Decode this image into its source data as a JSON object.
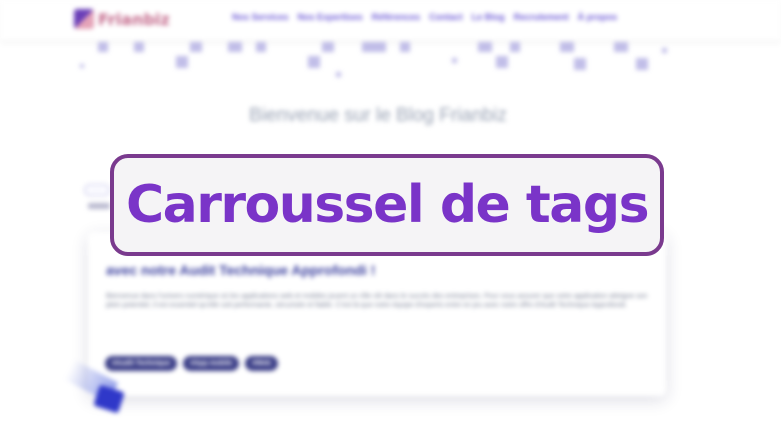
{
  "overlay": {
    "label": "Carroussel de tags"
  },
  "header": {
    "logo_text": "Frianbiz",
    "nav": [
      "Nos Services",
      "Nos Expertises",
      "Références",
      "Contact",
      "Le Blog",
      "Recrutement",
      "À propos"
    ]
  },
  "main": {
    "title": "Bienvenue sur le Blog Frianbiz",
    "article": {
      "title_line2": "avec notre Audit Technique Approfondi !",
      "excerpt": "Bienvenue dans l'univers numérique où les applications web et mobiles jouent un rôle clé dans le succès des entreprises. Pour vous assurer que votre application atteigne son plein potentiel, il est essentiel qu'elle soit performante, sécurisée et fiable. C'est là que notre équipe d'experts entre en jeu avec notre offre d'Audit Technique Approfondi.",
      "tags": [
        "#Audit Technique",
        "#App mobile",
        "#Web"
      ]
    }
  },
  "colors": {
    "overlay_border": "#7a3a8e",
    "overlay_text": "#7a34c8",
    "tag_bg": "#3c3f88",
    "nav_text": "#6d5ad6"
  }
}
